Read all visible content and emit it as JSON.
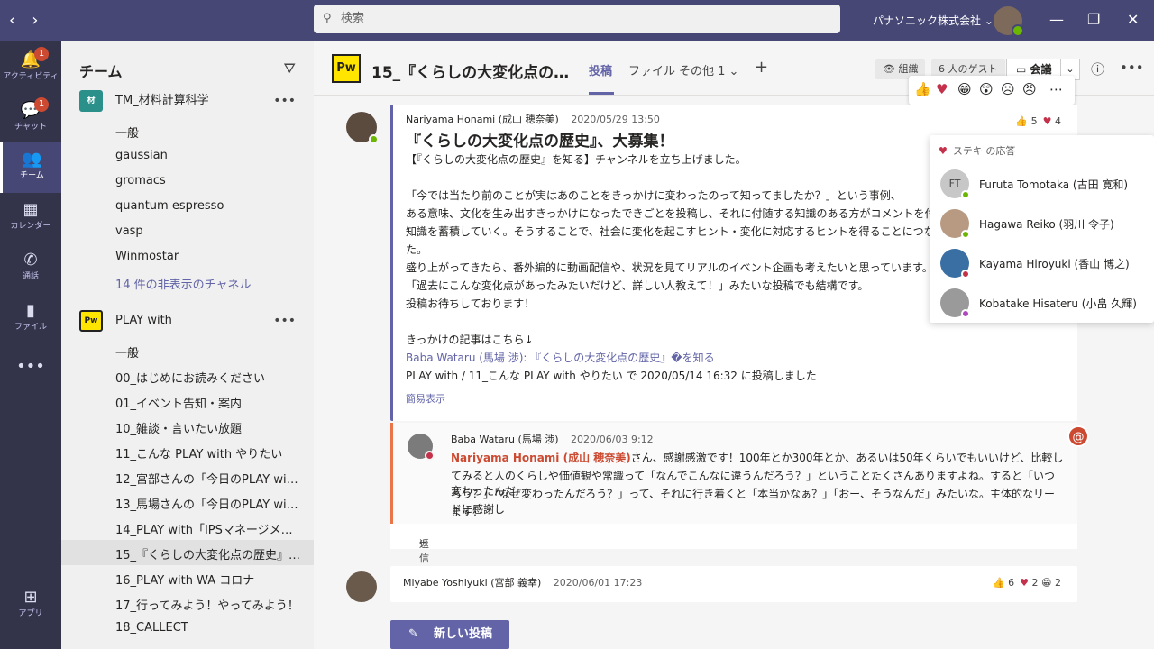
{
  "search": {
    "placeholder": "検索"
  },
  "org": {
    "name": "パナソニック株式会社"
  },
  "rail": {
    "activity": "アクティビティ",
    "activity_badge": "1",
    "chat": "チャット",
    "chat_badge": "1",
    "teams": "チーム",
    "calendar": "カレンダー",
    "calls": "通話",
    "files": "ファイル",
    "apps": "アプリ"
  },
  "sidebar": {
    "title": "チーム",
    "team1": {
      "name": "TM_材料計算科学",
      "icon": "材"
    },
    "team1_channels": [
      "一般",
      "gaussian",
      "gromacs",
      "quantum espresso",
      "vasp",
      "Winmostar"
    ],
    "team1_hidden": "14 件の非表示のチャネル",
    "team2": {
      "name": "PLAY with",
      "icon": "Pw"
    },
    "team2_channels": [
      "一般",
      "00_はじめにお読みください",
      "01_イベント告知・案内",
      "10_雑談・言いたい放題",
      "11_こんな PLAY with やりたい",
      "12_宮部さんの「今日のPLAY with」",
      "13_馬場さんの「今日のPLAY with」",
      "14_PLAY with「IPSマネージメントチ...",
      "15_『くらしの大変化点の歴史』を...",
      "16_PLAY with WA コロナ",
      "17_行ってみよう！やってみよう！",
      "18_CALLECT"
    ]
  },
  "channel": {
    "title": "15_『くらしの大変化点の歴...",
    "tab_posts": "投稿",
    "tab_files": "ファイル",
    "tab_more": "その他 1",
    "org_label": "組織",
    "guests": "6 人のゲスト",
    "meet": "会議"
  },
  "post1": {
    "author": "Nariyama Honami (成山 穂奈美)",
    "time": "2020/05/29 13:50",
    "title": "『くらしの大変化点の歴史』、大募集！",
    "lines": [
      "【『くらしの大変化点の歴史』を知る】チャンネルを立ち上げました。",
      "「今では当たり前のことが実はあのことをきっかけに変わったのって知ってましたか？」という事例、",
      "ある意味、文化を生み出すきっかけになったできごとを投稿し、それに付随する知識のある方がコメントを付け",
      "知識を蓄積していく。そうすることで、社会に変化を起こすヒント・変化に対応するヒントを得ることにつながれば",
      "た。",
      "盛り上がってきたら、番外編的に動画配信や、状況を見てリアルのイベント企画も考えたいと思っています。",
      "「過去にこんな変化点があったみたいだけど、詳しい人教えて！」みたいな投稿でも結構です。",
      "投稿お待ちしております！",
      "きっかけの記事はこちら↓"
    ],
    "link": "Baba Wataru (馬場 渉): 『くらしの大変化点の歴史』�を知る",
    "posted_in": "PLAY with / 11_こんな PLAY with やりたい で 2020/05/14 16:32 に投稿しました",
    "collapse": "簡易表示",
    "like_count": "5",
    "heart_count": "4"
  },
  "reply": {
    "author": "Baba Wataru (馬場 渉)",
    "time": "2020/06/03 9:12",
    "mention": "Nariyama Honami (成山 穂奈美)",
    "text_1": "さん、感謝感激です！100年とか300年とか、あるいは50年くらいでもいいけど、比較し",
    "text_2": "てみると人のくらしや価値観や常識って「なんでこんなに違うんだろう？」ということたくさんありますよね。すると「いつ変わったんだ",
    "text_3": "ろう？」「なぜ変わったんだろう？」って、それに行き着くと「本当かなぁ？」「おー、そうなんだ」みたいな。主体的なリードに感謝し",
    "text_4": "ます！",
    "reply_label": "返信"
  },
  "post2": {
    "author": "Miyabe Yoshiyuki (宮部 義幸)",
    "time": "2020/06/01 17:23",
    "like_count": "6",
    "heart_count": "2",
    "laugh_count": "2"
  },
  "new_post": "新しい投稿",
  "popup": {
    "title": "ステキ の応答",
    "people": [
      {
        "name": "Furuta Tomotaka (古田 寛和)",
        "initials": "FT",
        "status": "#6bb700"
      },
      {
        "name": "Hagawa Reiko (羽川 令子)",
        "initials": "",
        "status": "#6bb700"
      },
      {
        "name": "Kayama Hiroyuki (香山 博之)",
        "initials": "",
        "status": "#c4314b"
      },
      {
        "name": "Kobatake Hisateru (小畠 久輝)",
        "initials": "",
        "status": "#b146c2"
      }
    ]
  }
}
